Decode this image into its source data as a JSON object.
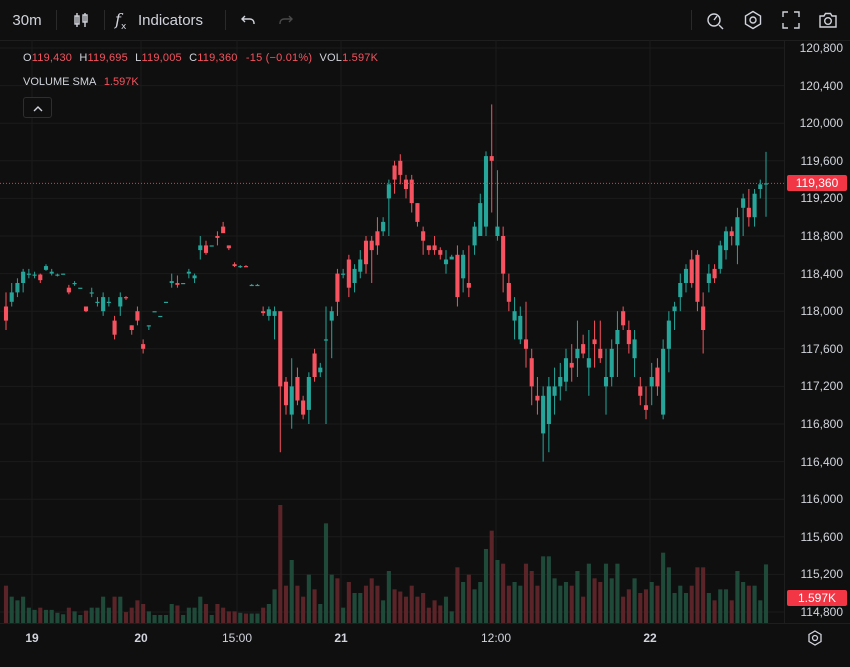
{
  "toolbar": {
    "interval": "30m",
    "indicators_label": "Indicators"
  },
  "legend": {
    "o_label": "O",
    "o_value": "119,430",
    "h_label": "H",
    "h_value": "119,695",
    "l_label": "L",
    "l_value": "119,005",
    "c_label": "C",
    "c_value": "119,360",
    "change": "-15 (−0.01%)",
    "vol_label": "VOL",
    "vol_value": "1.597K"
  },
  "sma": {
    "label": "VOLUME SMA",
    "value": "1.597K"
  },
  "price_axis": {
    "ticks": [
      "120,800",
      "120,400",
      "120,000",
      "119,600",
      "119,200",
      "118,800",
      "118,400",
      "118,000",
      "117,600",
      "117,200",
      "116,800",
      "116,400",
      "116,000",
      "115,600",
      "115,200",
      "114,800"
    ],
    "last_price": "119,360",
    "last_volume": "1.597K"
  },
  "time_axis": {
    "labels": [
      {
        "text": "19",
        "bold": true,
        "x": 32
      },
      {
        "text": "20",
        "bold": true,
        "x": 141
      },
      {
        "text": "15:00",
        "bold": false,
        "x": 237
      },
      {
        "text": "21",
        "bold": true,
        "x": 341
      },
      {
        "text": "12:00",
        "bold": false,
        "x": 496
      },
      {
        "text": "22",
        "bold": true,
        "x": 650
      }
    ]
  },
  "colors": {
    "up": "#26a69a",
    "down": "#f7525f",
    "up_vol": "#1f4a3a",
    "down_vol": "#5a2428",
    "last": "#f23645"
  },
  "icons": [
    "candles-icon",
    "fx-icon",
    "undo-icon",
    "redo-icon",
    "alert-icon",
    "settings-hex-icon",
    "fullscreen-icon",
    "camera-icon",
    "gear-icon",
    "chevron-up-icon"
  ],
  "chart_data": {
    "type": "candlestick",
    "ylim": [
      114800,
      120900
    ],
    "last_price": 119360,
    "candles": [
      [
        118050,
        118200,
        117800,
        117900
      ],
      [
        118100,
        118300,
        118050,
        118200
      ],
      [
        118200,
        118350,
        118150,
        118300
      ],
      [
        118300,
        118450,
        118200,
        118420
      ],
      [
        118400,
        118450,
        118350,
        118400
      ],
      [
        118380,
        118420,
        118350,
        118390
      ],
      [
        118390,
        118400,
        118300,
        118330
      ],
      [
        118440,
        118500,
        118430,
        118480
      ],
      [
        118400,
        118450,
        118380,
        118420
      ],
      [
        118380,
        118400,
        118370,
        118390
      ],
      [
        118400,
        118400,
        118390,
        118400
      ],
      [
        118250,
        118280,
        118180,
        118200
      ],
      [
        118300,
        118320,
        118270,
        118300
      ],
      [
        118250,
        118250,
        118250,
        118250
      ],
      [
        118050,
        118050,
        117990,
        118000
      ],
      [
        118200,
        118250,
        118150,
        118200
      ],
      [
        118100,
        118150,
        118050,
        118100
      ],
      [
        118000,
        118200,
        117950,
        118150
      ],
      [
        118100,
        118150,
        118050,
        118100
      ],
      [
        117900,
        117950,
        117700,
        117750
      ],
      [
        118050,
        118200,
        117950,
        118150
      ],
      [
        118150,
        118160,
        118120,
        118140
      ],
      [
        117850,
        117850,
        117750,
        117800
      ],
      [
        118000,
        118050,
        117850,
        117900
      ],
      [
        117650,
        117700,
        117550,
        117600
      ],
      [
        117850,
        117850,
        117800,
        117850
      ],
      [
        118000,
        117950,
        117950,
        118000
      ],
      [
        117950,
        117950,
        117950,
        117950
      ],
      [
        118100,
        118100,
        118100,
        118100
      ],
      [
        118300,
        118400,
        118250,
        118320
      ],
      [
        118300,
        118380,
        118250,
        118280
      ],
      [
        118300,
        118300,
        118300,
        118300
      ],
      [
        118400,
        118450,
        118350,
        118420
      ],
      [
        118350,
        118400,
        118300,
        118380
      ],
      [
        118650,
        118800,
        118550,
        118700
      ],
      [
        118700,
        118750,
        118600,
        118620
      ],
      [
        118700,
        118700,
        118700,
        118700
      ],
      [
        118800,
        118850,
        118700,
        118780
      ],
      [
        118900,
        118950,
        118850,
        118830
      ],
      [
        118700,
        118700,
        118650,
        118670
      ],
      [
        118500,
        118520,
        118470,
        118480
      ],
      [
        118470,
        118490,
        118460,
        118480
      ],
      [
        118480,
        118490,
        118470,
        118470
      ],
      [
        118280,
        118290,
        118270,
        118280
      ],
      [
        118280,
        118290,
        118270,
        118280
      ],
      [
        118000,
        118050,
        117950,
        117980
      ],
      [
        117950,
        118050,
        117900,
        118020
      ],
      [
        117950,
        118050,
        117700,
        118000
      ],
      [
        118000,
        118000,
        116500,
        117200
      ],
      [
        117250,
        117300,
        116900,
        117000
      ],
      [
        116900,
        117500,
        116750,
        117200
      ],
      [
        117300,
        117400,
        117000,
        117050
      ],
      [
        117050,
        117100,
        116850,
        116900
      ],
      [
        116950,
        117350,
        116800,
        117300
      ],
      [
        117550,
        117600,
        117250,
        117300
      ],
      [
        117350,
        117450,
        117300,
        117400
      ],
      [
        117700,
        118050,
        116800,
        117700
      ],
      [
        117900,
        118050,
        117500,
        118000
      ],
      [
        118400,
        118450,
        117950,
        118100
      ],
      [
        118400,
        118450,
        118350,
        118400
      ],
      [
        118550,
        118600,
        118150,
        118250
      ],
      [
        118300,
        118500,
        118200,
        118450
      ],
      [
        118420,
        118650,
        118350,
        118550
      ],
      [
        118750,
        118800,
        118400,
        118500
      ],
      [
        118750,
        118800,
        118300,
        118650
      ],
      [
        118850,
        119000,
        118600,
        118700
      ],
      [
        118850,
        119000,
        118800,
        118950
      ],
      [
        119200,
        119400,
        118800,
        119350
      ],
      [
        119550,
        119600,
        119250,
        119400
      ],
      [
        119600,
        119670,
        119350,
        119450
      ],
      [
        119400,
        119450,
        119200,
        119300
      ],
      [
        119400,
        119450,
        119050,
        119150
      ],
      [
        119150,
        119150,
        118900,
        118950
      ],
      [
        118850,
        118900,
        118600,
        118750
      ],
      [
        118700,
        118700,
        118600,
        118650
      ],
      [
        118700,
        118800,
        118600,
        118650
      ],
      [
        118650,
        118680,
        118550,
        118600
      ],
      [
        118500,
        118650,
        118400,
        118550
      ],
      [
        118550,
        118600,
        118550,
        118580
      ],
      [
        118600,
        118700,
        118050,
        118150
      ],
      [
        118350,
        118650,
        118200,
        118600
      ],
      [
        118300,
        118700,
        118150,
        118250
      ],
      [
        118700,
        118950,
        118600,
        118900
      ],
      [
        118800,
        119250,
        118800,
        119150
      ],
      [
        118900,
        119700,
        118800,
        119650
      ],
      [
        119650,
        120200,
        119050,
        119600
      ],
      [
        118800,
        119500,
        118750,
        118900
      ],
      [
        118800,
        118900,
        118200,
        118400
      ],
      [
        118300,
        118400,
        118000,
        118100
      ],
      [
        117900,
        118150,
        117700,
        118000
      ],
      [
        117700,
        118050,
        117650,
        117950
      ],
      [
        117700,
        118100,
        117400,
        117600
      ],
      [
        117500,
        117600,
        117000,
        117200
      ],
      [
        117100,
        117300,
        116900,
        117050
      ],
      [
        116700,
        117200,
        116400,
        117100
      ],
      [
        116800,
        117300,
        116500,
        117200
      ],
      [
        117100,
        117400,
        116900,
        117200
      ],
      [
        117200,
        117450,
        117050,
        117300
      ],
      [
        117250,
        117600,
        117150,
        117500
      ],
      [
        117450,
        117650,
        117250,
        117400
      ],
      [
        117500,
        117900,
        117300,
        117600
      ],
      [
        117650,
        117750,
        117500,
        117550
      ],
      [
        117400,
        117800,
        117100,
        117500
      ],
      [
        117700,
        117900,
        117400,
        117650
      ],
      [
        117600,
        117900,
        117450,
        117500
      ],
      [
        117200,
        117600,
        116900,
        117300
      ],
      [
        117300,
        117700,
        117200,
        117600
      ],
      [
        117650,
        118000,
        117300,
        117800
      ],
      [
        118000,
        118050,
        117800,
        117850
      ],
      [
        117800,
        117900,
        117550,
        117650
      ],
      [
        117500,
        117800,
        117300,
        117700
      ],
      [
        117200,
        117300,
        117000,
        117100
      ],
      [
        117000,
        117200,
        116850,
        116950
      ],
      [
        117200,
        117450,
        117000,
        117300
      ],
      [
        117400,
        117500,
        117100,
        117200
      ],
      [
        116900,
        117700,
        116850,
        117600
      ],
      [
        117600,
        118000,
        117350,
        117900
      ],
      [
        118000,
        118100,
        117800,
        118050
      ],
      [
        118150,
        118400,
        118000,
        118300
      ],
      [
        118300,
        118500,
        118200,
        118450
      ],
      [
        118550,
        118650,
        118250,
        118300
      ],
      [
        118600,
        118650,
        118000,
        118100
      ],
      [
        118050,
        118200,
        117550,
        117800
      ],
      [
        118300,
        118500,
        118200,
        118400
      ],
      [
        118450,
        118500,
        118300,
        118350
      ],
      [
        118450,
        118750,
        118400,
        118700
      ],
      [
        118650,
        118900,
        118550,
        118850
      ],
      [
        118850,
        118900,
        118700,
        118800
      ],
      [
        118700,
        119100,
        118500,
        119000
      ],
      [
        119100,
        119250,
        118800,
        119200
      ],
      [
        119100,
        119300,
        118900,
        119000
      ],
      [
        119000,
        119300,
        118900,
        119250
      ],
      [
        119300,
        119400,
        119200,
        119350
      ],
      [
        119360,
        119695,
        119005,
        119360
      ]
    ]
  }
}
